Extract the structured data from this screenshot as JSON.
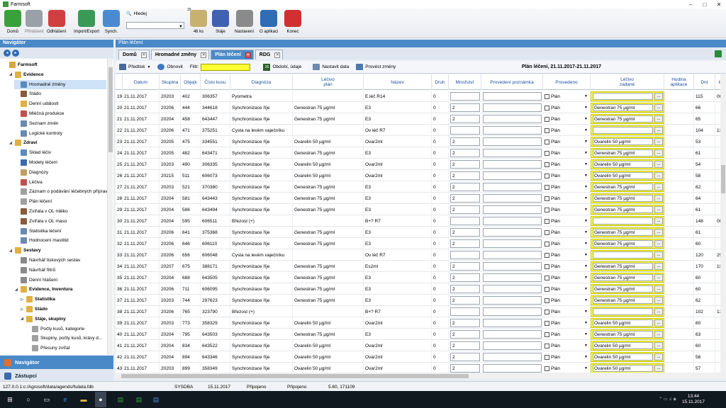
{
  "window": {
    "title": "Farmsoft",
    "minimize": "–",
    "maximize": "□",
    "close": "✕"
  },
  "ribbon": {
    "buttons": [
      {
        "label": "Domů",
        "icon": "home-icon",
        "color": "#3aa03a",
        "enabled": true
      },
      {
        "label": "Přihlášení",
        "icon": "login-database-icon",
        "color": "#9aa0a8",
        "enabled": false
      },
      {
        "label": "Odhlášení",
        "icon": "logout-database-icon",
        "color": "#d04040",
        "enabled": true
      },
      {
        "label": "Import/Export",
        "icon": "import-export-icon",
        "color": "#3a9a55",
        "enabled": true
      },
      {
        "label": "Synch.",
        "icon": "sync-icon",
        "color": "#4a8ad0",
        "enabled": true
      },
      {
        "label": "46 ks",
        "icon": "clipboard-icon",
        "color": "#c8b070",
        "enabled": true
      },
      {
        "label": "Stáje",
        "icon": "book-icon",
        "color": "#4060b0",
        "enabled": true
      },
      {
        "label": "Nastavení",
        "icon": "wrench-icon",
        "color": "#8a8a8a",
        "enabled": true
      },
      {
        "label": "O aplikaci",
        "icon": "help-icon",
        "color": "#2f6db5",
        "enabled": true
      },
      {
        "label": "Konec",
        "icon": "power-icon",
        "color": "#d03030",
        "enabled": true
      }
    ],
    "search": {
      "label": "Hledej",
      "value": ""
    },
    "badge_top": "15"
  },
  "navigator": {
    "title": "Navigátor",
    "tree": [
      {
        "label": "Farmsoft",
        "level": 0,
        "exp": "",
        "bold": true,
        "color": "#d6a640"
      },
      {
        "label": "Evidence",
        "level": 1,
        "exp": "◢",
        "bold": true,
        "color": "#e0b040"
      },
      {
        "label": "Hromadné změny",
        "level": 2,
        "exp": "",
        "bold": false,
        "color": "#5a8ac0",
        "selected": true
      },
      {
        "label": "Stádo",
        "level": 2,
        "exp": "",
        "bold": false,
        "color": "#8a5a3a"
      },
      {
        "label": "Denní události",
        "level": 2,
        "exp": "",
        "bold": false,
        "color": "#e0b040"
      },
      {
        "label": "Mléčná produkce",
        "level": 2,
        "exp": "",
        "bold": false,
        "color": "#c05050"
      },
      {
        "label": "Seznam změn",
        "level": 2,
        "exp": "",
        "bold": false,
        "color": "#6a8ab0"
      },
      {
        "label": "Logické kontroly",
        "level": 2,
        "exp": "",
        "bold": false,
        "color": "#6a8ab0"
      },
      {
        "label": "Zdraví",
        "level": 1,
        "exp": "◢",
        "bold": true,
        "color": "#e0b040"
      },
      {
        "label": "Sklad léčiv",
        "level": 2,
        "exp": "",
        "bold": false,
        "color": "#5a8ac0"
      },
      {
        "label": "Modely léčení",
        "level": 2,
        "exp": "",
        "bold": false,
        "color": "#3a6ab0"
      },
      {
        "label": "Diagnózy",
        "level": 2,
        "exp": "",
        "bold": false,
        "color": "#c0a060"
      },
      {
        "label": "Léčiva",
        "level": 2,
        "exp": "",
        "bold": false,
        "color": "#c05050"
      },
      {
        "label": "Záznam o podávání léčebných příprav",
        "level": 2,
        "exp": "",
        "bold": false,
        "color": "#a0a0a0"
      },
      {
        "label": "Plán léčení",
        "level": 2,
        "exp": "",
        "bold": false,
        "color": "#a0a0a0"
      },
      {
        "label": "Zvířata v OL mléko",
        "level": 2,
        "exp": "",
        "bold": false,
        "color": "#8a5a3a"
      },
      {
        "label": "Zvířata v OL maso",
        "level": 2,
        "exp": "",
        "bold": false,
        "color": "#8a5a3a"
      },
      {
        "label": "Statistika léčení",
        "level": 2,
        "exp": "",
        "bold": false,
        "color": "#6a8ab0"
      },
      {
        "label": "Hodnocení mastitid",
        "level": 2,
        "exp": "",
        "bold": false,
        "color": "#6a8ab0"
      },
      {
        "label": "Sestavy",
        "level": 1,
        "exp": "◢",
        "bold": true,
        "color": "#e0b040"
      },
      {
        "label": "Návrhář tiskových sestav",
        "level": 2,
        "exp": "",
        "bold": false,
        "color": "#8a8a8a"
      },
      {
        "label": "Návrhář filtrů",
        "level": 2,
        "exp": "",
        "bold": false,
        "color": "#8a8a8a"
      },
      {
        "label": "Denní hlášení",
        "level": 2,
        "exp": "",
        "bold": false,
        "color": "#8a8a8a"
      },
      {
        "label": "Evidence, Inventura",
        "level": 2,
        "exp": "◢",
        "bold": true,
        "color": "#e0b040"
      },
      {
        "label": "Statistika",
        "level": 3,
        "exp": "▷",
        "bold": true,
        "color": "#e0b040"
      },
      {
        "label": "Stádo",
        "level": 3,
        "exp": "▷",
        "bold": true,
        "color": "#e0b040"
      },
      {
        "label": "Stáje, skupiny",
        "level": 3,
        "exp": "◢",
        "bold": true,
        "color": "#e0b040"
      },
      {
        "label": "Počty kusů, kategorie",
        "level": 4,
        "exp": "",
        "bold": false,
        "color": "#a0a0a0"
      },
      {
        "label": "Skupiny, počty kusů, krávy d...",
        "level": 4,
        "exp": "",
        "bold": false,
        "color": "#a0a0a0"
      },
      {
        "label": "Přesuny zvířat",
        "level": 4,
        "exp": "",
        "bold": false,
        "color": "#a0a0a0"
      }
    ],
    "bottom_nav": "Navigátor",
    "bottom_zastupci": "Zástupci"
  },
  "main": {
    "title": "Plán léčení",
    "tabs": [
      {
        "label": "Domů",
        "active": false
      },
      {
        "label": "Hromadné změny",
        "active": false
      },
      {
        "label": "Plán léčení",
        "active": true
      },
      {
        "label": "RDG",
        "active": false
      }
    ],
    "toolbar": {
      "predtisk": "Předtisk",
      "obnovit": "Obnovit",
      "filtr": "Filtr:",
      "obdobi_num": "26",
      "obdobi": "Období, údaje",
      "nastavit": "Nastavit data",
      "provest": "Provést změny",
      "period": "Plán léčení, 21.11.2017-21.11.2017"
    }
  },
  "grid": {
    "columns": [
      {
        "label": "",
        "sub": ""
      },
      {
        "label": "Datum",
        "sub": ""
      },
      {
        "label": "Skupina",
        "sub": ""
      },
      {
        "label": "Objejk",
        "sub": ""
      },
      {
        "label": "Číslo kusu",
        "sub": ""
      },
      {
        "label": "Diagnóza",
        "sub": ""
      },
      {
        "label": "Léčivo",
        "sub": "plán"
      },
      {
        "label": "Název",
        "sub": ""
      },
      {
        "label": "Druh",
        "sub": ""
      },
      {
        "label": "Množství",
        "sub": ""
      },
      {
        "label": "Provedení poznámka",
        "sub": ""
      },
      {
        "label": "Provedeno",
        "sub": ""
      },
      {
        "label": "Léčivo",
        "sub": "zadané"
      },
      {
        "label": "Hodina",
        "sub": "aplikace"
      },
      {
        "label": "Dní",
        "sub": ""
      },
      {
        "label": "Ir",
        "sub": ""
      }
    ],
    "plan_label": "Plán",
    "rows": [
      {
        "n": "19",
        "datum": "21.11.2017",
        "skupina": "20203",
        "objekt": "402",
        "cislo": "306357",
        "diagnoza": "Pyometra",
        "lecivo": "",
        "nazev": "E.léč R14",
        "druh": "0",
        "mnozstvi": "",
        "zadane": "",
        "dni": "115",
        "ir": "06.1"
      },
      {
        "n": "20",
        "datum": "21.11.2017",
        "skupina": "20206",
        "objekt": "444",
        "cislo": "344618",
        "diagnoza": "Synchronizace říje",
        "lecivo": "Genestran 75 µg/ml",
        "nazev": "E3",
        "druh": "0",
        "mnozstvi": "2",
        "zadane": "Genestran 75 µg/ml",
        "dni": "66",
        "ir": ""
      },
      {
        "n": "21",
        "datum": "21.11.2017",
        "skupina": "20204",
        "objekt": "458",
        "cislo": "643447",
        "diagnoza": "Synchronizace říje",
        "lecivo": "Genestran 75 µg/ml",
        "nazev": "E3",
        "druh": "0",
        "mnozstvi": "2",
        "zadane": "Genestran 75 µg/ml",
        "dni": "65",
        "ir": ""
      },
      {
        "n": "22",
        "datum": "21.11.2017",
        "skupina": "20206",
        "objekt": "471",
        "cislo": "375251",
        "diagnoza": "Cysta na levém vaječníku",
        "lecivo": "",
        "nazev": "Ov léč R7",
        "druh": "0",
        "mnozstvi": "",
        "zadane": "",
        "dni": "104",
        "ir": "13.1"
      },
      {
        "n": "23",
        "datum": "21.11.2017",
        "skupina": "20205",
        "objekt": "475",
        "cislo": "334551",
        "diagnoza": "Synchronizace říje",
        "lecivo": "Ovarelin 50 µg/ml",
        "nazev": "Ovar2ml",
        "druh": "0",
        "mnozstvi": "2",
        "zadane": "Ovarelin 50 µg/ml",
        "dni": "53",
        "ir": ""
      },
      {
        "n": "24",
        "datum": "21.11.2017",
        "skupina": "20205",
        "objekt": "482",
        "cislo": "643471",
        "diagnoza": "Synchronizace říje",
        "lecivo": "Genestran 75 µg/ml",
        "nazev": "E3",
        "druh": "0",
        "mnozstvi": "2",
        "zadane": "Genestran 75 µg/ml",
        "dni": "61",
        "ir": ""
      },
      {
        "n": "25",
        "datum": "21.11.2017",
        "skupina": "20203",
        "objekt": "490",
        "cislo": "306335",
        "diagnoza": "Synchronizace říje",
        "lecivo": "Ovarelin 50 µg/ml",
        "nazev": "Ovar2ml",
        "druh": "0",
        "mnozstvi": "2",
        "zadane": "Ovarelin 50 µg/ml",
        "dni": "54",
        "ir": ""
      },
      {
        "n": "26",
        "datum": "21.11.2017",
        "skupina": "20215",
        "objekt": "511",
        "cislo": "606073",
        "diagnoza": "Synchronizace říje",
        "lecivo": "Ovarelin 50 µg/ml",
        "nazev": "Ovar2ml",
        "druh": "0",
        "mnozstvi": "2",
        "zadane": "Ovarelin 50 µg/ml",
        "dni": "58",
        "ir": ""
      },
      {
        "n": "27",
        "datum": "21.11.2017",
        "skupina": "20203",
        "objekt": "521",
        "cislo": "370380",
        "diagnoza": "Synchronizace říje",
        "lecivo": "Genestran 75 µg/ml",
        "nazev": "E3",
        "druh": "0",
        "mnozstvi": "2",
        "zadane": "Genestran 75 µg/ml",
        "dni": "62",
        "ir": ""
      },
      {
        "n": "28",
        "datum": "21.11.2017",
        "skupina": "20204",
        "objekt": "581",
        "cislo": "643443",
        "diagnoza": "Synchronizace říje",
        "lecivo": "Genestran 75 µg/ml",
        "nazev": "E3",
        "druh": "0",
        "mnozstvi": "2",
        "zadane": "Genestran 75 µg/ml",
        "dni": "64",
        "ir": ""
      },
      {
        "n": "29",
        "datum": "21.11.2017",
        "skupina": "20204",
        "objekt": "586",
        "cislo": "643494",
        "diagnoza": "Synchronizace říje",
        "lecivo": "Genestran 75 µg/ml",
        "nazev": "E3",
        "druh": "0",
        "mnozstvi": "2",
        "zadane": "Genestran 75 µg/ml",
        "dni": "61",
        "ir": ""
      },
      {
        "n": "30",
        "datum": "21.11.2017",
        "skupina": "20204",
        "objekt": "595",
        "cislo": "606511",
        "diagnoza": "Březost (+)",
        "lecivo": "",
        "nazev": "B+? R7",
        "druh": "0",
        "mnozstvi": "",
        "zadane": "",
        "dni": "148",
        "ir": "06.1"
      },
      {
        "n": "31",
        "datum": "21.11.2017",
        "skupina": "20206",
        "objekt": "641",
        "cislo": "375368",
        "diagnoza": "Synchronizace říje",
        "lecivo": "Genestran 75 µg/ml",
        "nazev": "E3",
        "druh": "0",
        "mnozstvi": "2",
        "zadane": "Genestran 75 µg/ml",
        "dni": "61",
        "ir": ""
      },
      {
        "n": "32",
        "datum": "21.11.2017",
        "skupina": "20206",
        "objekt": "646",
        "cislo": "606110",
        "diagnoza": "Synchronizace říje",
        "lecivo": "Genestran 75 µg/ml",
        "nazev": "E3",
        "druh": "0",
        "mnozstvi": "2",
        "zadane": "Genestran 75 µg/ml",
        "dni": "60",
        "ir": ""
      },
      {
        "n": "33",
        "datum": "21.11.2017",
        "skupina": "20206",
        "objekt": "656",
        "cislo": "606048",
        "diagnoza": "Cysta na levém vaječníku",
        "lecivo": "",
        "nazev": "Ov léč R7",
        "druh": "0",
        "mnozstvi": "",
        "zadane": "",
        "dni": "120",
        "ir": "29.0"
      },
      {
        "n": "34",
        "datum": "21.11.2017",
        "skupina": "20207",
        "objekt": "675",
        "cislo": "388171",
        "diagnoza": "Synchronizace říje",
        "lecivo": "Genestran 75 µg/ml",
        "nazev": "Es2ml",
        "druh": "0",
        "mnozstvi": "2",
        "zadane": "Genestran 75 µg/ml",
        "dni": "170",
        "ir": "11.1"
      },
      {
        "n": "35",
        "datum": "21.11.2017",
        "skupina": "20204",
        "objekt": "688",
        "cislo": "643505",
        "diagnoza": "Synchronizace říje",
        "lecivo": "Genestran 75 µg/ml",
        "nazev": "E3",
        "druh": "0",
        "mnozstvi": "2",
        "zadane": "Genestran 75 µg/ml",
        "dni": "60",
        "ir": ""
      },
      {
        "n": "36",
        "datum": "21.11.2017",
        "skupina": "20206",
        "objekt": "711",
        "cislo": "606095",
        "diagnoza": "Synchronizace říje",
        "lecivo": "Genestran 75 µg/ml",
        "nazev": "E3",
        "druh": "0",
        "mnozstvi": "2",
        "zadane": "Genestran 75 µg/ml",
        "dni": "60",
        "ir": ""
      },
      {
        "n": "37",
        "datum": "21.11.2017",
        "skupina": "20203",
        "objekt": "744",
        "cislo": "297623",
        "diagnoza": "Synchronizace říje",
        "lecivo": "Genestran 75 µg/ml",
        "nazev": "E3",
        "druh": "0",
        "mnozstvi": "2",
        "zadane": "Genestran 75 µg/ml",
        "dni": "62",
        "ir": ""
      },
      {
        "n": "38",
        "datum": "21.11.2017",
        "skupina": "20206",
        "objekt": "765",
        "cislo": "323790",
        "diagnoza": "Březost (+)",
        "lecivo": "",
        "nazev": "B+? R7",
        "druh": "0",
        "mnozstvi": "",
        "zadane": "",
        "dni": "102",
        "ir": "13.1"
      },
      {
        "n": "39",
        "datum": "21.11.2017",
        "skupina": "20203",
        "objekt": "773",
        "cislo": "358329",
        "diagnoza": "Synchronizace říje",
        "lecivo": "Ovarelin 50 µg/ml",
        "nazev": "Ovar2ml",
        "druh": "0",
        "mnozstvi": "2",
        "zadane": "Ovarelin 50 µg/ml",
        "dni": "60",
        "ir": ""
      },
      {
        "n": "40",
        "datum": "21.11.2017",
        "skupina": "20204",
        "objekt": "795",
        "cislo": "643503",
        "diagnoza": "Synchronizace říje",
        "lecivo": "Genestran 75 µg/ml",
        "nazev": "E3",
        "druh": "0",
        "mnozstvi": "2",
        "zadane": "Genestran 75 µg/ml",
        "dni": "63",
        "ir": ""
      },
      {
        "n": "41",
        "datum": "21.11.2017",
        "skupina": "20204",
        "objekt": "834",
        "cislo": "643522",
        "diagnoza": "Synchronizace říje",
        "lecivo": "Ovarelin 50 µg/ml",
        "nazev": "Ovar2ml",
        "druh": "0",
        "mnozstvi": "2",
        "zadane": "Ovarelin 50 µg/ml",
        "dni": "60",
        "ir": ""
      },
      {
        "n": "42",
        "datum": "21.11.2017",
        "skupina": "20204",
        "objekt": "894",
        "cislo": "643346",
        "diagnoza": "Synchronizace říje",
        "lecivo": "Ovarelin 50 µg/ml",
        "nazev": "Ovar2ml",
        "druh": "0",
        "mnozstvi": "2",
        "zadane": "Ovarelin 50 µg/ml",
        "dni": "56",
        "ir": ""
      },
      {
        "n": "43",
        "datum": "21.11.2017",
        "skupina": "20203",
        "objekt": "899",
        "cislo": "358349",
        "diagnoza": "Synchronizace říje",
        "lecivo": "Ovarelin 50 µg/ml",
        "nazev": "Ovar2ml",
        "druh": "0",
        "mnozstvi": "2",
        "zadane": "Ovarelin 50 µg/ml",
        "dni": "57",
        "ir": ""
      }
    ]
  },
  "status": {
    "path": "127.0.0.1:c:/Agrosoft/data/agends/fsdata.fdb",
    "user": "SYSDBA",
    "date": "15.11.2017",
    "conn1": "Připojeno",
    "conn2": "Připojeno",
    "version": "5.60, 171109"
  },
  "taskbar": {
    "time": "13:44",
    "date": "15.11.2017"
  }
}
